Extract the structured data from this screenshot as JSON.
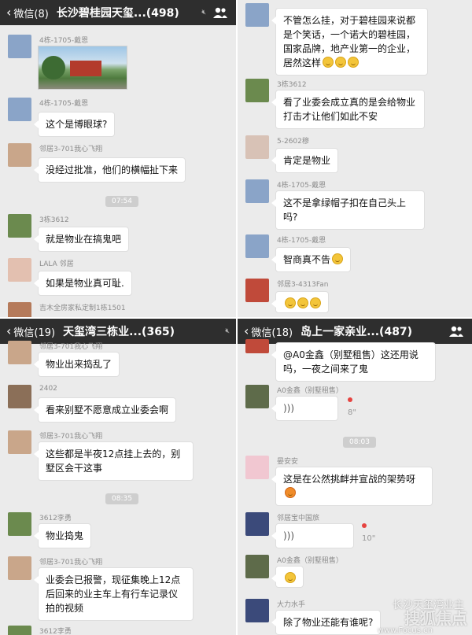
{
  "panels": [
    {
      "header": {
        "back": "微信(8)",
        "title": "长沙碧桂园天玺...(498)"
      },
      "times": [
        "07:54"
      ],
      "messages": [
        {
          "sender": "4栋-1705-戴恩",
          "text": ""
        },
        {
          "sender": "4栋-1705-戴恩",
          "text": "这个是博眼球?"
        },
        {
          "sender": "邻居3-701我心飞翔",
          "text": "没经过批准，他们的横幅扯下来"
        },
        {
          "sender": "3栋3612",
          "text": "就是物业在搞鬼吧"
        },
        {
          "sender": "LALA 邻居",
          "text": "如果是物业真可耻."
        },
        {
          "sender": "吉木全房家私定制1栋1501",
          "text": ""
        }
      ]
    },
    {
      "header": {
        "back": "",
        "title": ""
      },
      "messages": [
        {
          "sender": "",
          "text": "不管怎么挂，对于碧桂园来说都是个笑话，一个诺大的碧桂园，国家品牌，地产业第一的企业，居然这样"
        },
        {
          "sender": "3栋3612",
          "text": "看了业委会成立真的是会给物业打击才让他们如此不安"
        },
        {
          "sender": "5-2602穆",
          "text": "肯定是物业"
        },
        {
          "sender": "4栋-1705-戴恩",
          "text": "这不是拿绿帽子扣在自己头上吗?"
        },
        {
          "sender": "4栋-1705-戴恩",
          "text": "智商真不告"
        },
        {
          "sender": "邻居3-4313Fan",
          "text": ""
        }
      ]
    },
    {
      "header": {
        "back": "微信(19)",
        "title": "天玺湾三栋业...(365)"
      },
      "times": [
        "08:35"
      ],
      "messages": [
        {
          "sender": "邻居3-701我心飞翔",
          "text": "物业出来捣乱了"
        },
        {
          "sender": "2402",
          "text": "看来别墅不愿意成立业委会啊"
        },
        {
          "sender": "邻居3-701我心飞翔",
          "text": "这些都是半夜12点挂上去的，别墅区会干这事"
        },
        {
          "sender": "3612李勇",
          "text": "物业捣鬼"
        },
        {
          "sender": "邻居3-701我心飞翔",
          "text": "业委会已报警，现征集晚上12点后回来的业主车上有行车记录仪拍的视频"
        },
        {
          "sender": "3612李勇",
          "text": ""
        }
      ]
    },
    {
      "header": {
        "back": "微信(18)",
        "title": "岛上一家亲业...(487)"
      },
      "times": [
        "08:03"
      ],
      "messages": [
        {
          "sender": "",
          "text": "@A0金鑫（别墅租售）这还用说吗，一夜之间来了鬼"
        },
        {
          "sender": "A0金鑫（别墅租售）",
          "text": "",
          "duration": "8\""
        },
        {
          "sender": "晏安安",
          "text": "这是在公然挑衅并宣战的架势呀"
        },
        {
          "sender": "邻居宝中国旅",
          "text": "",
          "duration": "10\""
        },
        {
          "sender": "A0金鑫（别墅租售）",
          "text": ""
        },
        {
          "sender": "大力水手",
          "text": "除了物业还能有谁呢?"
        }
      ]
    }
  ],
  "watermark": {
    "main": "搜狐焦点",
    "sub": "长沙天玺湾业主",
    "url": "www.Focus.cn"
  },
  "colors": {
    "header": "#2e2e2e",
    "chat_bg": "#ebebeb",
    "bubble": "#ffffff",
    "name": "#8c8c8c"
  }
}
